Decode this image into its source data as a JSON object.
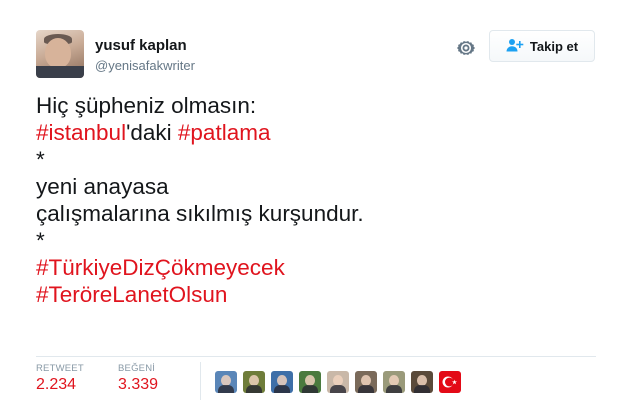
{
  "user": {
    "name": "yusuf kaplan",
    "handle": "@yenisafakwriter"
  },
  "actions": {
    "follow_label": "Takip et"
  },
  "tweet": {
    "lines": [
      [
        {
          "text": "Hiç şüpheniz olmasın:",
          "hashtag": false
        }
      ],
      [
        {
          "text": "#istanbul",
          "hashtag": true
        },
        {
          "text": "'daki ",
          "hashtag": false
        },
        {
          "text": "#patlama",
          "hashtag": true
        }
      ],
      [
        {
          "text": "*",
          "hashtag": false
        }
      ],
      [
        {
          "text": "yeni anayasa",
          "hashtag": false
        }
      ],
      [
        {
          "text": "çalışmalarına sıkılmış kurşundur.",
          "hashtag": false
        }
      ],
      [
        {
          "text": "*",
          "hashtag": false
        }
      ],
      [
        {
          "text": "#TürkiyeDizÇökmeyecek",
          "hashtag": true
        }
      ],
      [
        {
          "text": "#TeröreLanetOlsun",
          "hashtag": true
        }
      ]
    ]
  },
  "stats": {
    "retweet_label": "RETWEET",
    "retweet_count": "2.234",
    "likes_label": "BEĞENİ",
    "likes_count": "3.339"
  },
  "likers": [
    {
      "name": "liker-avatar-1",
      "bg": "#5a86b8"
    },
    {
      "name": "liker-avatar-2",
      "bg": "#6f7d3a"
    },
    {
      "name": "liker-avatar-3",
      "bg": "#3e6fa8"
    },
    {
      "name": "liker-avatar-4",
      "bg": "#4a7a3e"
    },
    {
      "name": "liker-avatar-5",
      "bg": "#c9b8a8"
    },
    {
      "name": "liker-avatar-6",
      "bg": "#7a6a5a"
    },
    {
      "name": "liker-avatar-7",
      "bg": "#9a9a7a"
    },
    {
      "name": "liker-avatar-8",
      "bg": "#5a4a3a"
    },
    {
      "name": "liker-avatar-flag",
      "bg": "#e30a17",
      "flag": true
    }
  ],
  "colors": {
    "hashtag": "#e0141e",
    "text": "#14171a",
    "muted": "#657786",
    "divider": "#e1e8ed"
  },
  "icons": [
    "gear-icon",
    "follow-person-icon",
    "turkish-flag-icon"
  ]
}
